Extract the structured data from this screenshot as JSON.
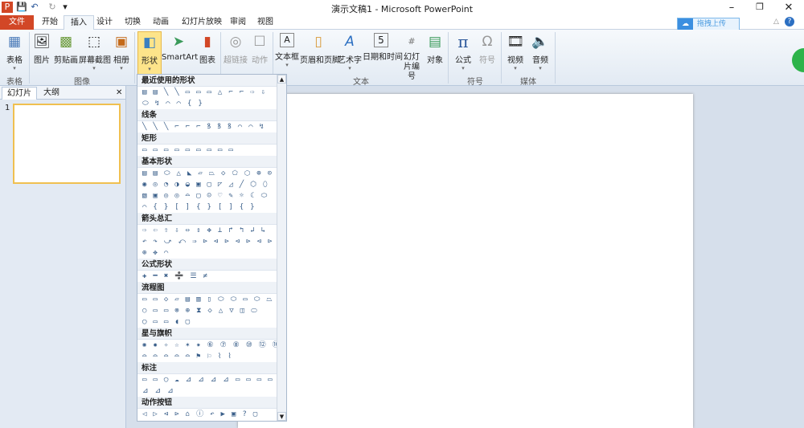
{
  "window": {
    "title": "演示文稿1 - Microsoft PowerPoint",
    "minimize": "–",
    "restore": "❐",
    "close": "✕"
  },
  "quick_access": {
    "app_icon": "P",
    "save": "💾",
    "undo": "↶",
    "redo": "↻",
    "customize": "▾"
  },
  "tabs": [
    {
      "label": "文件"
    },
    {
      "label": "开始"
    },
    {
      "label": "插入"
    },
    {
      "label": "设计"
    },
    {
      "label": "切换"
    },
    {
      "label": "动画"
    },
    {
      "label": "幻灯片放映"
    },
    {
      "label": "审阅"
    },
    {
      "label": "视图"
    }
  ],
  "upload": {
    "label": "拖拽上传",
    "icon": "cloud-icon"
  },
  "help": {
    "minimize_ribbon": "△",
    "help": "?"
  },
  "ribbon": {
    "buttons": [
      {
        "label": "表格",
        "icon": "▦",
        "arrow": "▾"
      },
      {
        "label": "图片",
        "icon": "🖼"
      },
      {
        "label": "剪贴画",
        "icon": "▩"
      },
      {
        "label": "屏幕截图",
        "icon": "⬚",
        "arrow": "▾"
      },
      {
        "label": "相册",
        "icon": "▣",
        "arrow": "▾"
      },
      {
        "label": "形状",
        "icon": "◧",
        "arrow": "▾"
      },
      {
        "label": "SmartArt",
        "icon": "➤"
      },
      {
        "label": "图表",
        "icon": "▮"
      },
      {
        "label": "超链接",
        "icon": "◎"
      },
      {
        "label": "动作",
        "icon": "☐"
      },
      {
        "label": "文本框",
        "icon": "A",
        "arrow": "▾"
      },
      {
        "label": "页眉和页脚",
        "icon": "▯"
      },
      {
        "label": "艺术字",
        "icon": "A",
        "arrow": "▾"
      },
      {
        "label": "日期和时间",
        "icon": "5"
      },
      {
        "label": "幻灯片编号",
        "icon": "#"
      },
      {
        "label": "对象",
        "icon": "▤"
      },
      {
        "label": "公式",
        "icon": "π",
        "arrow": "▾"
      },
      {
        "label": "符号",
        "icon": "Ω"
      },
      {
        "label": "视频",
        "icon": "🎞",
        "arrow": "▾"
      },
      {
        "label": "音频",
        "icon": "🔈",
        "arrow": "▾"
      }
    ],
    "groups": [
      "表格",
      "图像",
      "文本",
      "符号",
      "媒体"
    ]
  },
  "left_pane": {
    "tabs": [
      "幻灯片",
      "大纲"
    ],
    "close": "✕",
    "slide_number": "1"
  },
  "shapes_panel": {
    "scroll_up": "▲",
    "scroll_down": "▼",
    "sections": [
      {
        "title": "最近使用的形状",
        "rows": [
          "▤▤╲╲▭▭▭△⌐⌐⇨⇩",
          "⬭↯⌒⌒{}"
        ]
      },
      {
        "title": "线条",
        "rows": [
          "╲╲╲⌐⌐⌐ꝸꝸꝸ⌒⌒↯"
        ]
      },
      {
        "title": "矩形",
        "rows": [
          "▭▭▭▭▭▭▭▭▭"
        ]
      },
      {
        "title": "基本形状",
        "rows": [
          "▤▤⬭△◣▱⏢◇⬠⬡⊕⊙",
          "◉◎◔◑◒▣▢◸◿╱⬡⬯",
          "▧▣◎◎⌓▢☺♡✎☼☾⬭",
          "⌒{}[]{}[]{}"
        ]
      },
      {
        "title": "箭头总汇",
        "rows": [
          "⇨⇦⇧⇩⇔⇕✥⊥↱↰↲↳",
          "↶↷⤻⤺⇒⊳⊲⊳⊲⊳⊲⊳",
          "⊕✥⌒"
        ]
      },
      {
        "title": "公式形状",
        "rows": [
          "✚━✖➗☰≠"
        ]
      },
      {
        "title": "流程图",
        "rows": [
          "▭▭◇▱▤▥▯⬭⬭▭⬭⏢",
          "○▭▭⊗⊕⧗◇△▽◫⬭",
          "◯▭▭◖▢"
        ]
      },
      {
        "title": "星与旗帜",
        "rows": [
          "✺✹✧☆✶✷⑥⑦⑧⑩⑫⑯",
          "⌓⌓⌓⌓⌓⚑⚐⌇⌇"
        ]
      },
      {
        "title": "标注",
        "rows": [
          "▭▭◯☁⊿⊿⊿⊿▭▭▭▭",
          "⊿⊿⊿"
        ]
      },
      {
        "title": "动作按钮",
        "rows": [
          "◁▷⊲⊳⌂ⓘ↶▶▣?▢"
        ]
      }
    ]
  }
}
